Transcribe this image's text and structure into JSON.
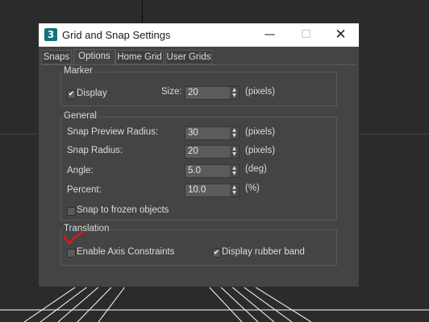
{
  "window": {
    "title": "Grid and Snap Settings",
    "app_icon_glyph": "3",
    "minimize_glyph": "—",
    "maximize_glyph": "☐",
    "close_glyph": "✕"
  },
  "tabs": [
    {
      "label": "Snaps",
      "active": false
    },
    {
      "label": "Options",
      "active": true
    },
    {
      "label": "Home Grid",
      "active": false
    },
    {
      "label": "User Grids",
      "active": false
    }
  ],
  "marker": {
    "group_label": "Marker",
    "display_label": "Display",
    "display_checked": true,
    "size_label": "Size:",
    "size_value": "20",
    "size_unit": "(pixels)"
  },
  "general": {
    "group_label": "General",
    "rows": [
      {
        "label": "Snap Preview Radius:",
        "value": "30",
        "unit": "(pixels)"
      },
      {
        "label": "Snap Radius:",
        "value": "20",
        "unit": "(pixels)"
      },
      {
        "label": "Angle:",
        "value": "5.0",
        "unit": "(deg)"
      },
      {
        "label": "Percent:",
        "value": "10.0",
        "unit": "(%)"
      }
    ],
    "frozen_label": "Snap to frozen objects",
    "frozen_checked": false
  },
  "translation": {
    "group_label": "Translation",
    "axis_label": "Enable Axis Constraints",
    "axis_checked": false,
    "rubber_label": "Display rubber band",
    "rubber_checked": true
  },
  "colors": {
    "background": "#2b2b2b",
    "dialog": "#444444",
    "titlebar": "#ffffff",
    "app_icon": "#13737b",
    "annotation_mark": "#e0191b"
  },
  "icons": {
    "app": "3ds-max-icon",
    "spinner": "up-down-arrows-icon",
    "annotation": "red-checkmark-annotation"
  }
}
